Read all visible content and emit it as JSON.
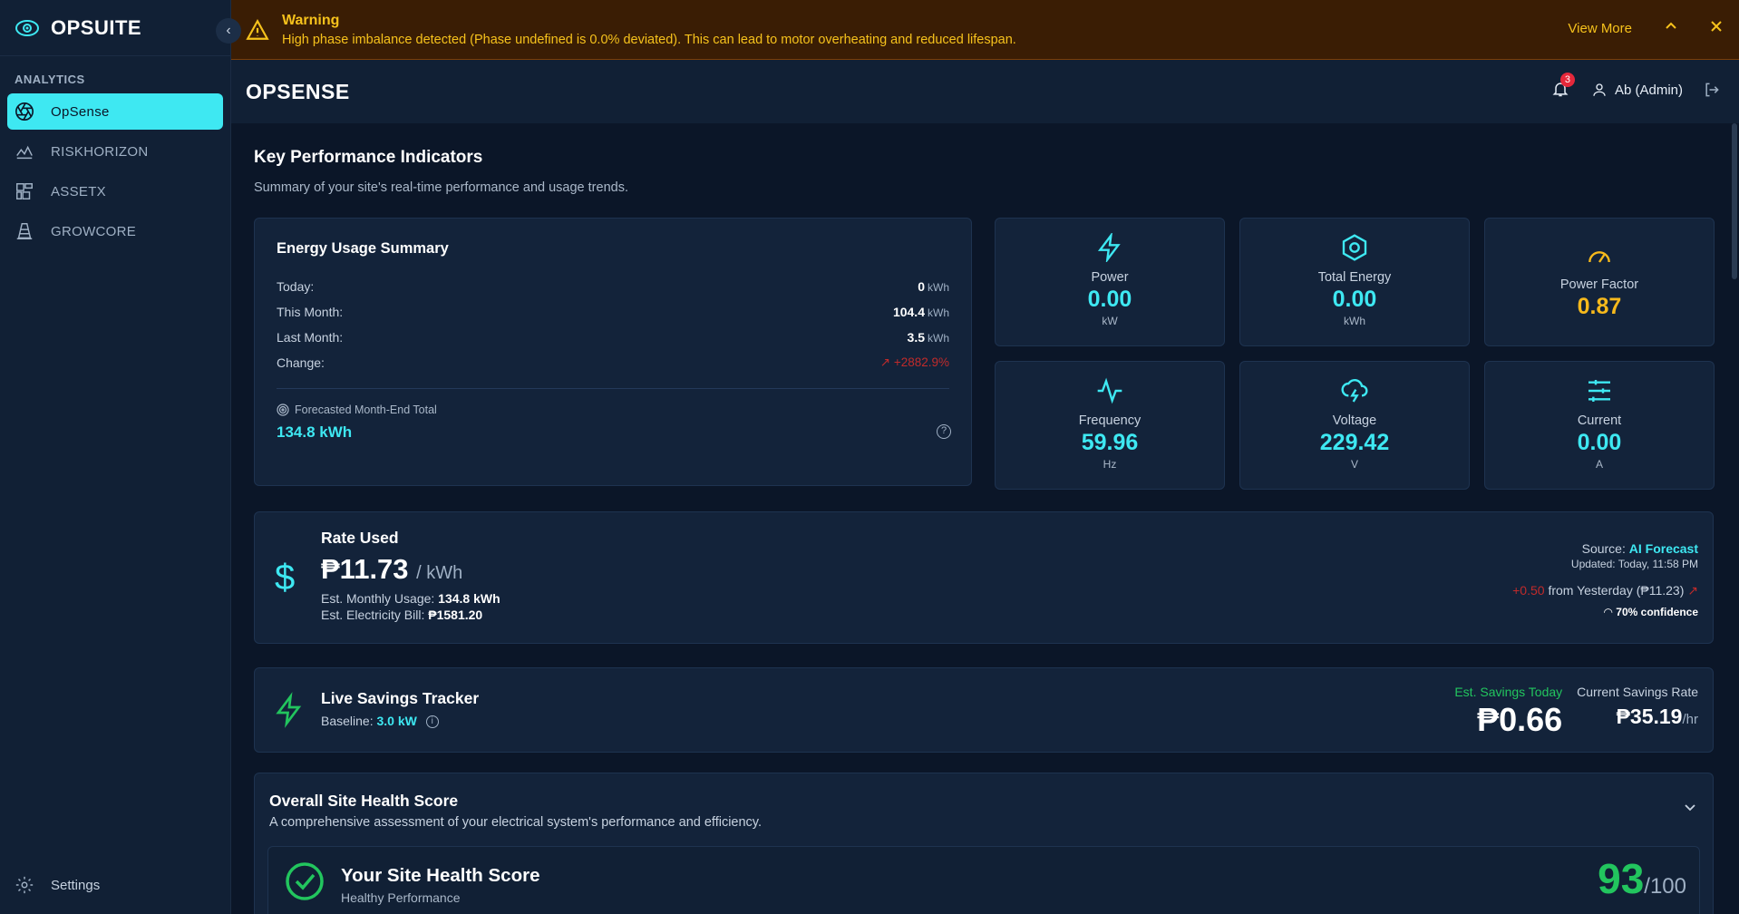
{
  "brand": {
    "name": "OPSUITE"
  },
  "sidebar": {
    "section_label": "ANALYTICS",
    "items": [
      {
        "label": "OpSense",
        "icon": "aperture-icon"
      },
      {
        "label": "RISKHORIZON",
        "icon": "area-chart-icon"
      },
      {
        "label": "ASSETX",
        "icon": "assets-icon"
      },
      {
        "label": "GROWCORE",
        "icon": "cone-icon"
      }
    ],
    "settings_label": "Settings"
  },
  "warning": {
    "title": "Warning",
    "message": "High phase imbalance detected (Phase undefined is 0.0% deviated). This can lead to motor overheating and reduced lifespan.",
    "view_more": "View More"
  },
  "header": {
    "title": "OPSENSE",
    "notification_count": "3",
    "user": "Ab (Admin)"
  },
  "kpi": {
    "title": "Key Performance Indicators",
    "subtitle": "Summary of your site's real-time performance and usage trends."
  },
  "energy_summary": {
    "title": "Energy Usage Summary",
    "rows": [
      {
        "label": "Today:",
        "value": "0",
        "unit": "kWh"
      },
      {
        "label": "This Month:",
        "value": "104.4",
        "unit": "kWh"
      },
      {
        "label": "Last Month:",
        "value": "3.5",
        "unit": "kWh"
      }
    ],
    "change_label": "Change:",
    "change_value": "+2882.9%",
    "forecast_label": "Forecasted Month-End Total",
    "forecast_value": "134.8 kWh"
  },
  "metrics": [
    {
      "label": "Power",
      "value": "0.00",
      "unit": "kW"
    },
    {
      "label": "Total Energy",
      "value": "0.00",
      "unit": "kWh"
    },
    {
      "label": "Power Factor",
      "value": "0.87",
      "unit": ""
    },
    {
      "label": "Frequency",
      "value": "59.96",
      "unit": "Hz"
    },
    {
      "label": "Voltage",
      "value": "229.42",
      "unit": "V"
    },
    {
      "label": "Current",
      "value": "0.00",
      "unit": "A"
    }
  ],
  "rate": {
    "title": "Rate Used",
    "price": "₱11.73",
    "per": "/ kWh",
    "monthly_usage_label": "Est. Monthly Usage:",
    "monthly_usage_value": "134.8 kWh",
    "bill_label": "Est. Electricity Bill:",
    "bill_value": "₱1581.20",
    "source_label": "Source:",
    "source_value": "AI Forecast",
    "updated": "Updated: Today, 11:58 PM",
    "delta": "+0.50",
    "delta_text": "from Yesterday (₱11.23)",
    "confidence": "70% confidence"
  },
  "savings": {
    "title": "Live Savings Tracker",
    "baseline_label": "Baseline:",
    "baseline_value": "3.0 kW",
    "today_label": "Est. Savings Today",
    "today_value": "₱0.66",
    "rate_label": "Current Savings Rate",
    "rate_value": "₱35.19",
    "rate_unit": "/hr"
  },
  "health": {
    "title": "Overall Site Health Score",
    "subtitle": "A comprehensive assessment of your electrical system's performance and efficiency.",
    "inner_title": "Your Site Health Score",
    "inner_sub": "Healthy Performance",
    "score": "93",
    "score_max": "/100"
  },
  "colors": {
    "accent": "#3ee8f2",
    "warning": "#f6c21c",
    "positive": "#22c55e",
    "negative": "#c02b2b",
    "power_factor": "#f6b91c"
  }
}
